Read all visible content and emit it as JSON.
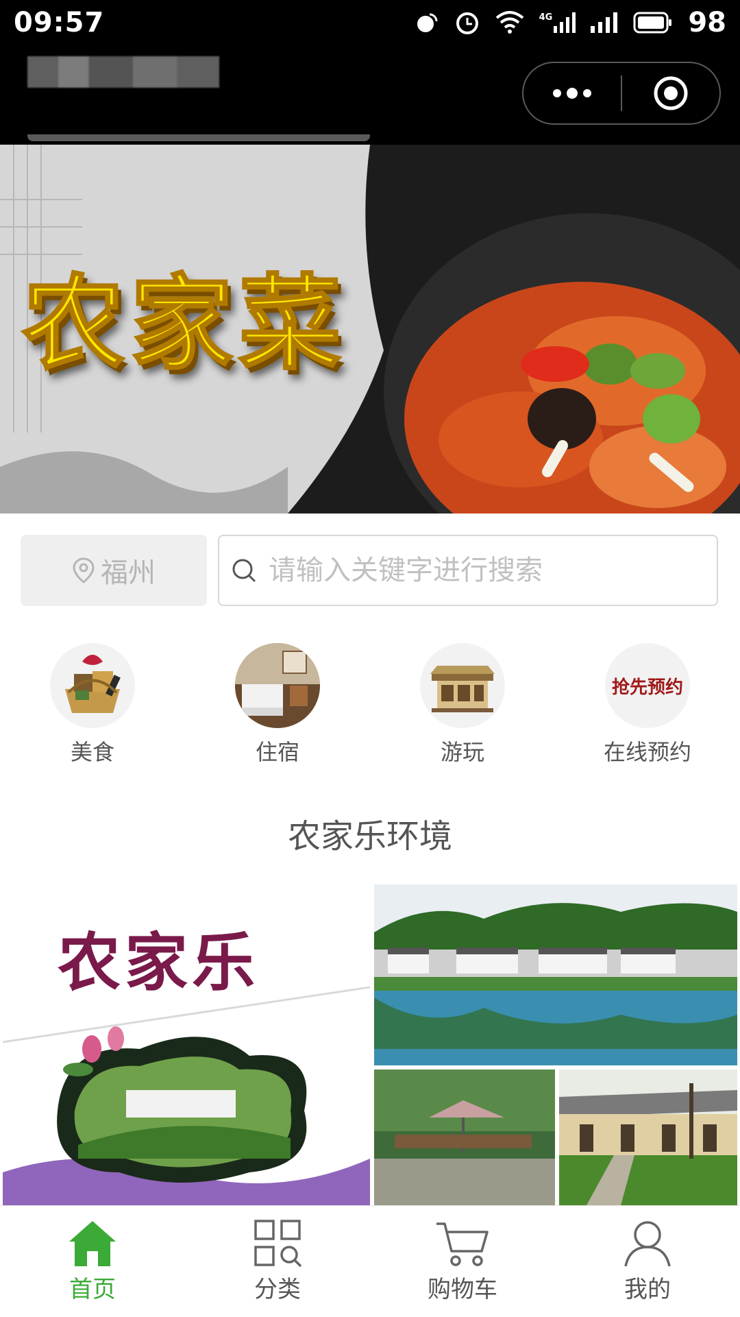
{
  "status_bar": {
    "time": "09:57",
    "battery": "98",
    "network": "4G"
  },
  "banner": {
    "title": "农家菜",
    "dots": 3,
    "active_dot": 0
  },
  "location": {
    "city": "福州"
  },
  "search": {
    "placeholder": "请输入关键字进行搜索"
  },
  "categories": [
    {
      "label": "美食",
      "icon": "gift-basket-icon"
    },
    {
      "label": "住宿",
      "icon": "hotel-room-icon"
    },
    {
      "label": "游玩",
      "icon": "pavilion-icon"
    },
    {
      "label": "在线预约",
      "icon": "booking-icon",
      "icon_text": "抢先预约"
    }
  ],
  "section": {
    "title": "农家乐环境"
  },
  "environment": {
    "poster_title": "农家乐"
  },
  "tabbar": [
    {
      "label": "首页",
      "icon": "home-icon",
      "active": true
    },
    {
      "label": "分类",
      "icon": "category-grid-icon",
      "active": false
    },
    {
      "label": "购物车",
      "icon": "cart-icon",
      "active": false
    },
    {
      "label": "我的",
      "icon": "user-icon",
      "active": false
    }
  ],
  "colors": {
    "accent": "#3caa36",
    "status_bar": "#000000",
    "text": "#555555",
    "placeholder": "#c0c0c0"
  }
}
